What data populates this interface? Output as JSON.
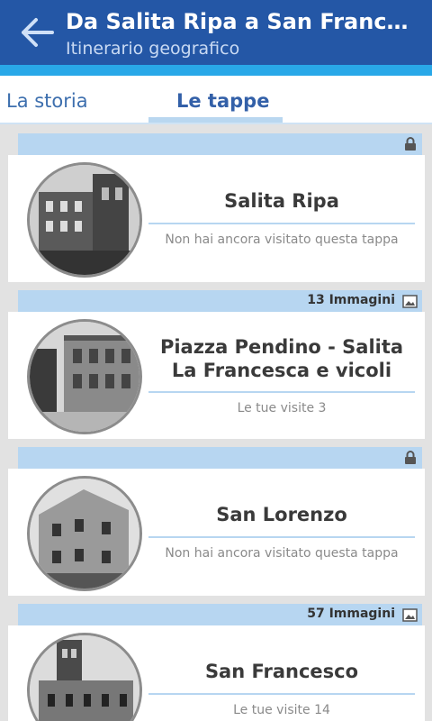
{
  "header": {
    "title": "Da Salita Ripa a San Francesco",
    "subtitle": "Itinerario geografico"
  },
  "tabs": [
    {
      "label": "La storia",
      "selected": false
    },
    {
      "label": "Le tappe",
      "selected": true
    }
  ],
  "stops": [
    {
      "name": "Salita Ripa",
      "status": "Non hai ancora visitato questa tappa",
      "locked": true,
      "images": ""
    },
    {
      "name": "Piazza Pendino - Salita La Francesca e vicoli",
      "status": "Le tue visite 3",
      "locked": false,
      "images": "13 Immagini"
    },
    {
      "name": "San Lorenzo",
      "status": "Non hai ancora visitato questa tappa",
      "locked": true,
      "images": ""
    },
    {
      "name": "San Francesco",
      "status": "Le tue visite 14",
      "locked": false,
      "images": "57 Immagini"
    }
  ],
  "colors": {
    "appbar": "#2457a6",
    "accent": "#29a8e8",
    "header_strip": "#b7d6f1"
  }
}
